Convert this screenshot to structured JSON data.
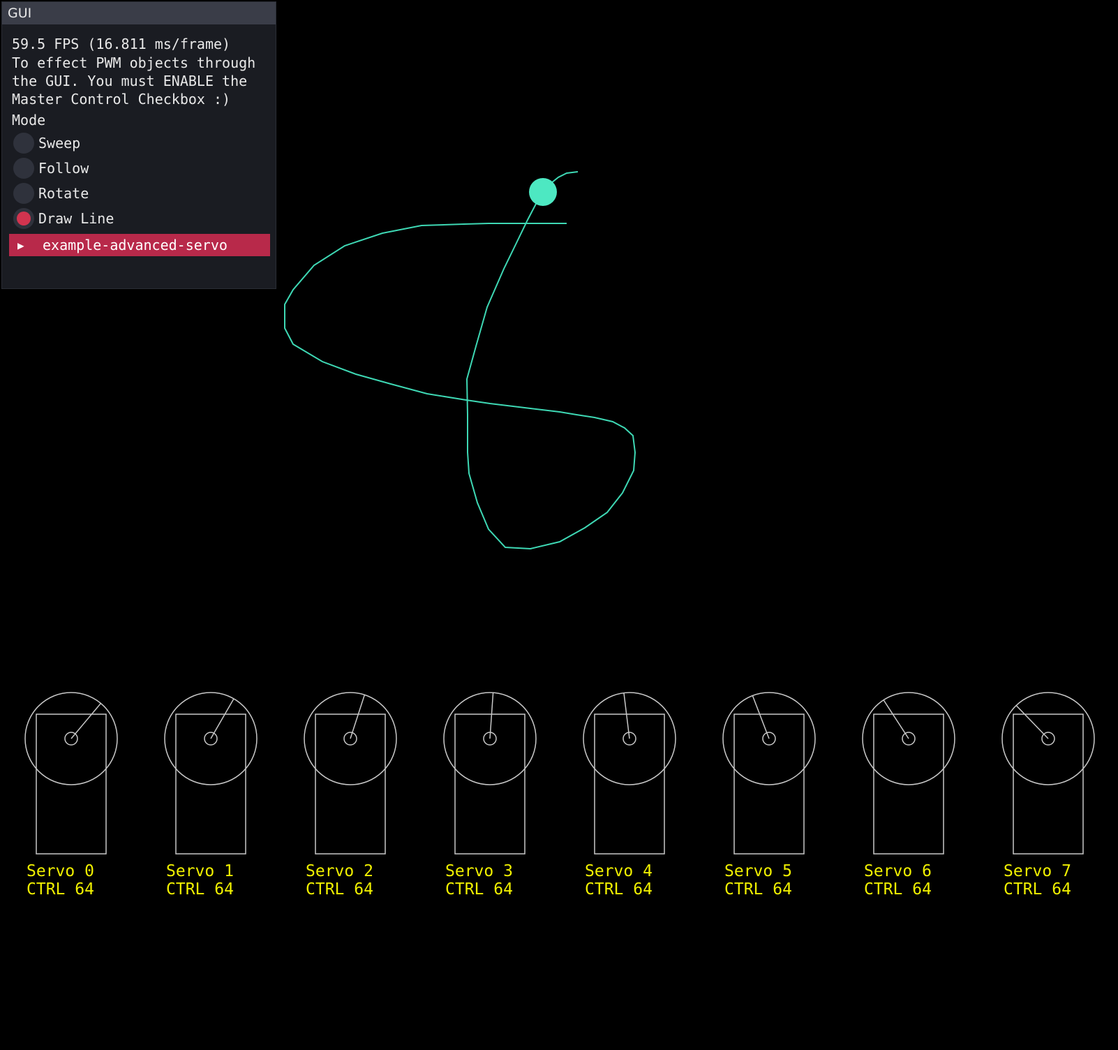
{
  "gui": {
    "title": "GUI",
    "fps": "59.5 FPS (16.811 ms/frame)",
    "info": "To effect PWM objects through the GUI. You must ENABLE the Master Control Checkbox :)",
    "mode_label": "Mode",
    "modes": [
      {
        "label": "Sweep",
        "selected": false
      },
      {
        "label": "Follow",
        "selected": false
      },
      {
        "label": "Rotate",
        "selected": false
      },
      {
        "label": "Draw Line",
        "selected": true
      }
    ],
    "collapse_label": "example-advanced-servo"
  },
  "colors": {
    "trail": "#3ed8b4",
    "cursor": "#4de8c2",
    "servo_outline": "#c8c8c8",
    "servo_text": "#f0f000",
    "accent": "#b8294a"
  },
  "servos": [
    {
      "name": "Servo 0",
      "ctrl": "CTRL 64",
      "angle_deg": 50
    },
    {
      "name": "Servo 1",
      "ctrl": "CTRL 64",
      "angle_deg": 60
    },
    {
      "name": "Servo 2",
      "ctrl": "CTRL 64",
      "angle_deg": 72
    },
    {
      "name": "Servo 3",
      "ctrl": "CTRL 64",
      "angle_deg": 86
    },
    {
      "name": "Servo 4",
      "ctrl": "CTRL 64",
      "angle_deg": 97
    },
    {
      "name": "Servo 5",
      "ctrl": "CTRL 64",
      "angle_deg": 111
    },
    {
      "name": "Servo 6",
      "ctrl": "CTRL 64",
      "angle_deg": 123
    },
    {
      "name": "Servo 7",
      "ctrl": "CTRL 64",
      "angle_deg": 134
    }
  ]
}
